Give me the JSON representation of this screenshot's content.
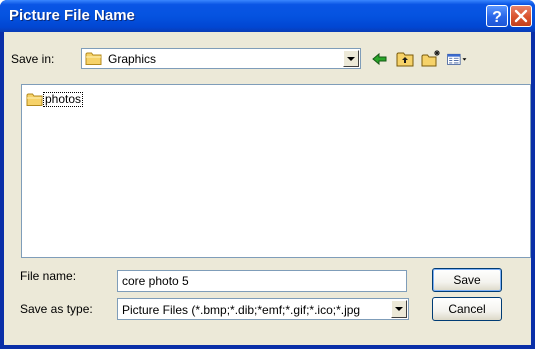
{
  "window": {
    "title": "Picture File Name",
    "help_button": "?",
    "close_button": "X"
  },
  "toolbar": {
    "save_in_label": "Save in:",
    "save_in_value": "Graphics",
    "icons": [
      "back-arrow-icon",
      "up-one-level-icon",
      "new-folder-icon",
      "views-menu-icon"
    ]
  },
  "file_list": {
    "items": [
      {
        "name": "photos",
        "type": "folder"
      }
    ]
  },
  "file_name": {
    "label": "File name:",
    "value": "core photo 5"
  },
  "save_as_type": {
    "label": "Save as type:",
    "value": "Picture Files (*.bmp;*.dib;*emf;*.gif;*.ico;*.jpg"
  },
  "buttons": {
    "save": "Save",
    "cancel": "Cancel"
  },
  "colors": {
    "titlebar": "#0553e0",
    "dialog_face": "#ece9d8",
    "field_border": "#7f9db9",
    "button_border": "#003c74"
  }
}
